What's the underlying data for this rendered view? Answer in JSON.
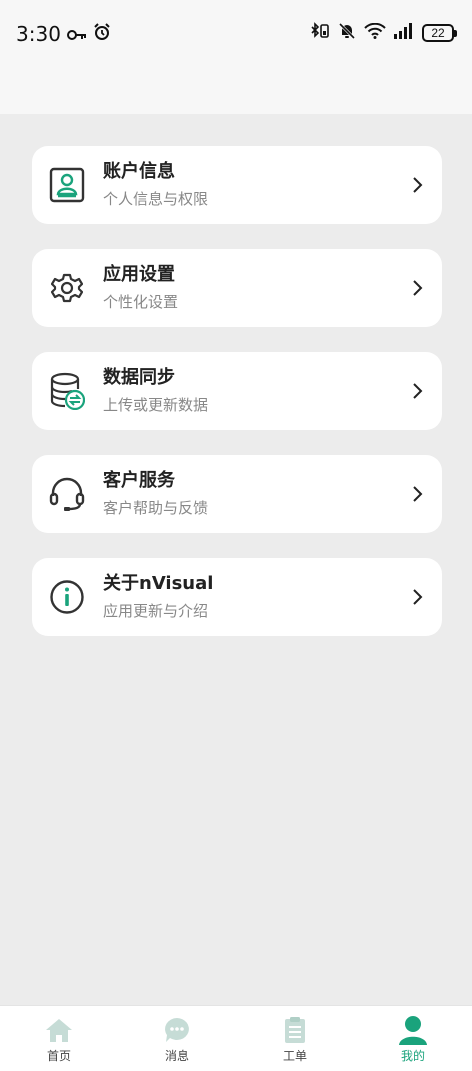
{
  "status_bar": {
    "time": "3:30",
    "battery": "22"
  },
  "menu": [
    {
      "title": "账户信息",
      "subtitle": "个人信息与权限",
      "icon": "account-card-icon"
    },
    {
      "title": "应用设置",
      "subtitle": "个性化设置",
      "icon": "gear-icon"
    },
    {
      "title": "数据同步",
      "subtitle": "上传或更新数据",
      "icon": "database-sync-icon"
    },
    {
      "title": "客户服务",
      "subtitle": "客户帮助与反馈",
      "icon": "headset-icon"
    },
    {
      "title": "关于nVisual",
      "subtitle": "应用更新与介绍",
      "icon": "info-icon"
    }
  ],
  "tabs": [
    {
      "label": "首页",
      "icon": "home-icon",
      "active": false
    },
    {
      "label": "消息",
      "icon": "chat-bubble-icon",
      "active": false
    },
    {
      "label": "工单",
      "icon": "clipboard-icon",
      "active": false
    },
    {
      "label": "我的",
      "icon": "user-icon",
      "active": true
    }
  ],
  "colors": {
    "accent": "#1aa37c",
    "inactive_tab_icon": "#c6dcd6",
    "background": "#ececec",
    "card": "#ffffff"
  }
}
